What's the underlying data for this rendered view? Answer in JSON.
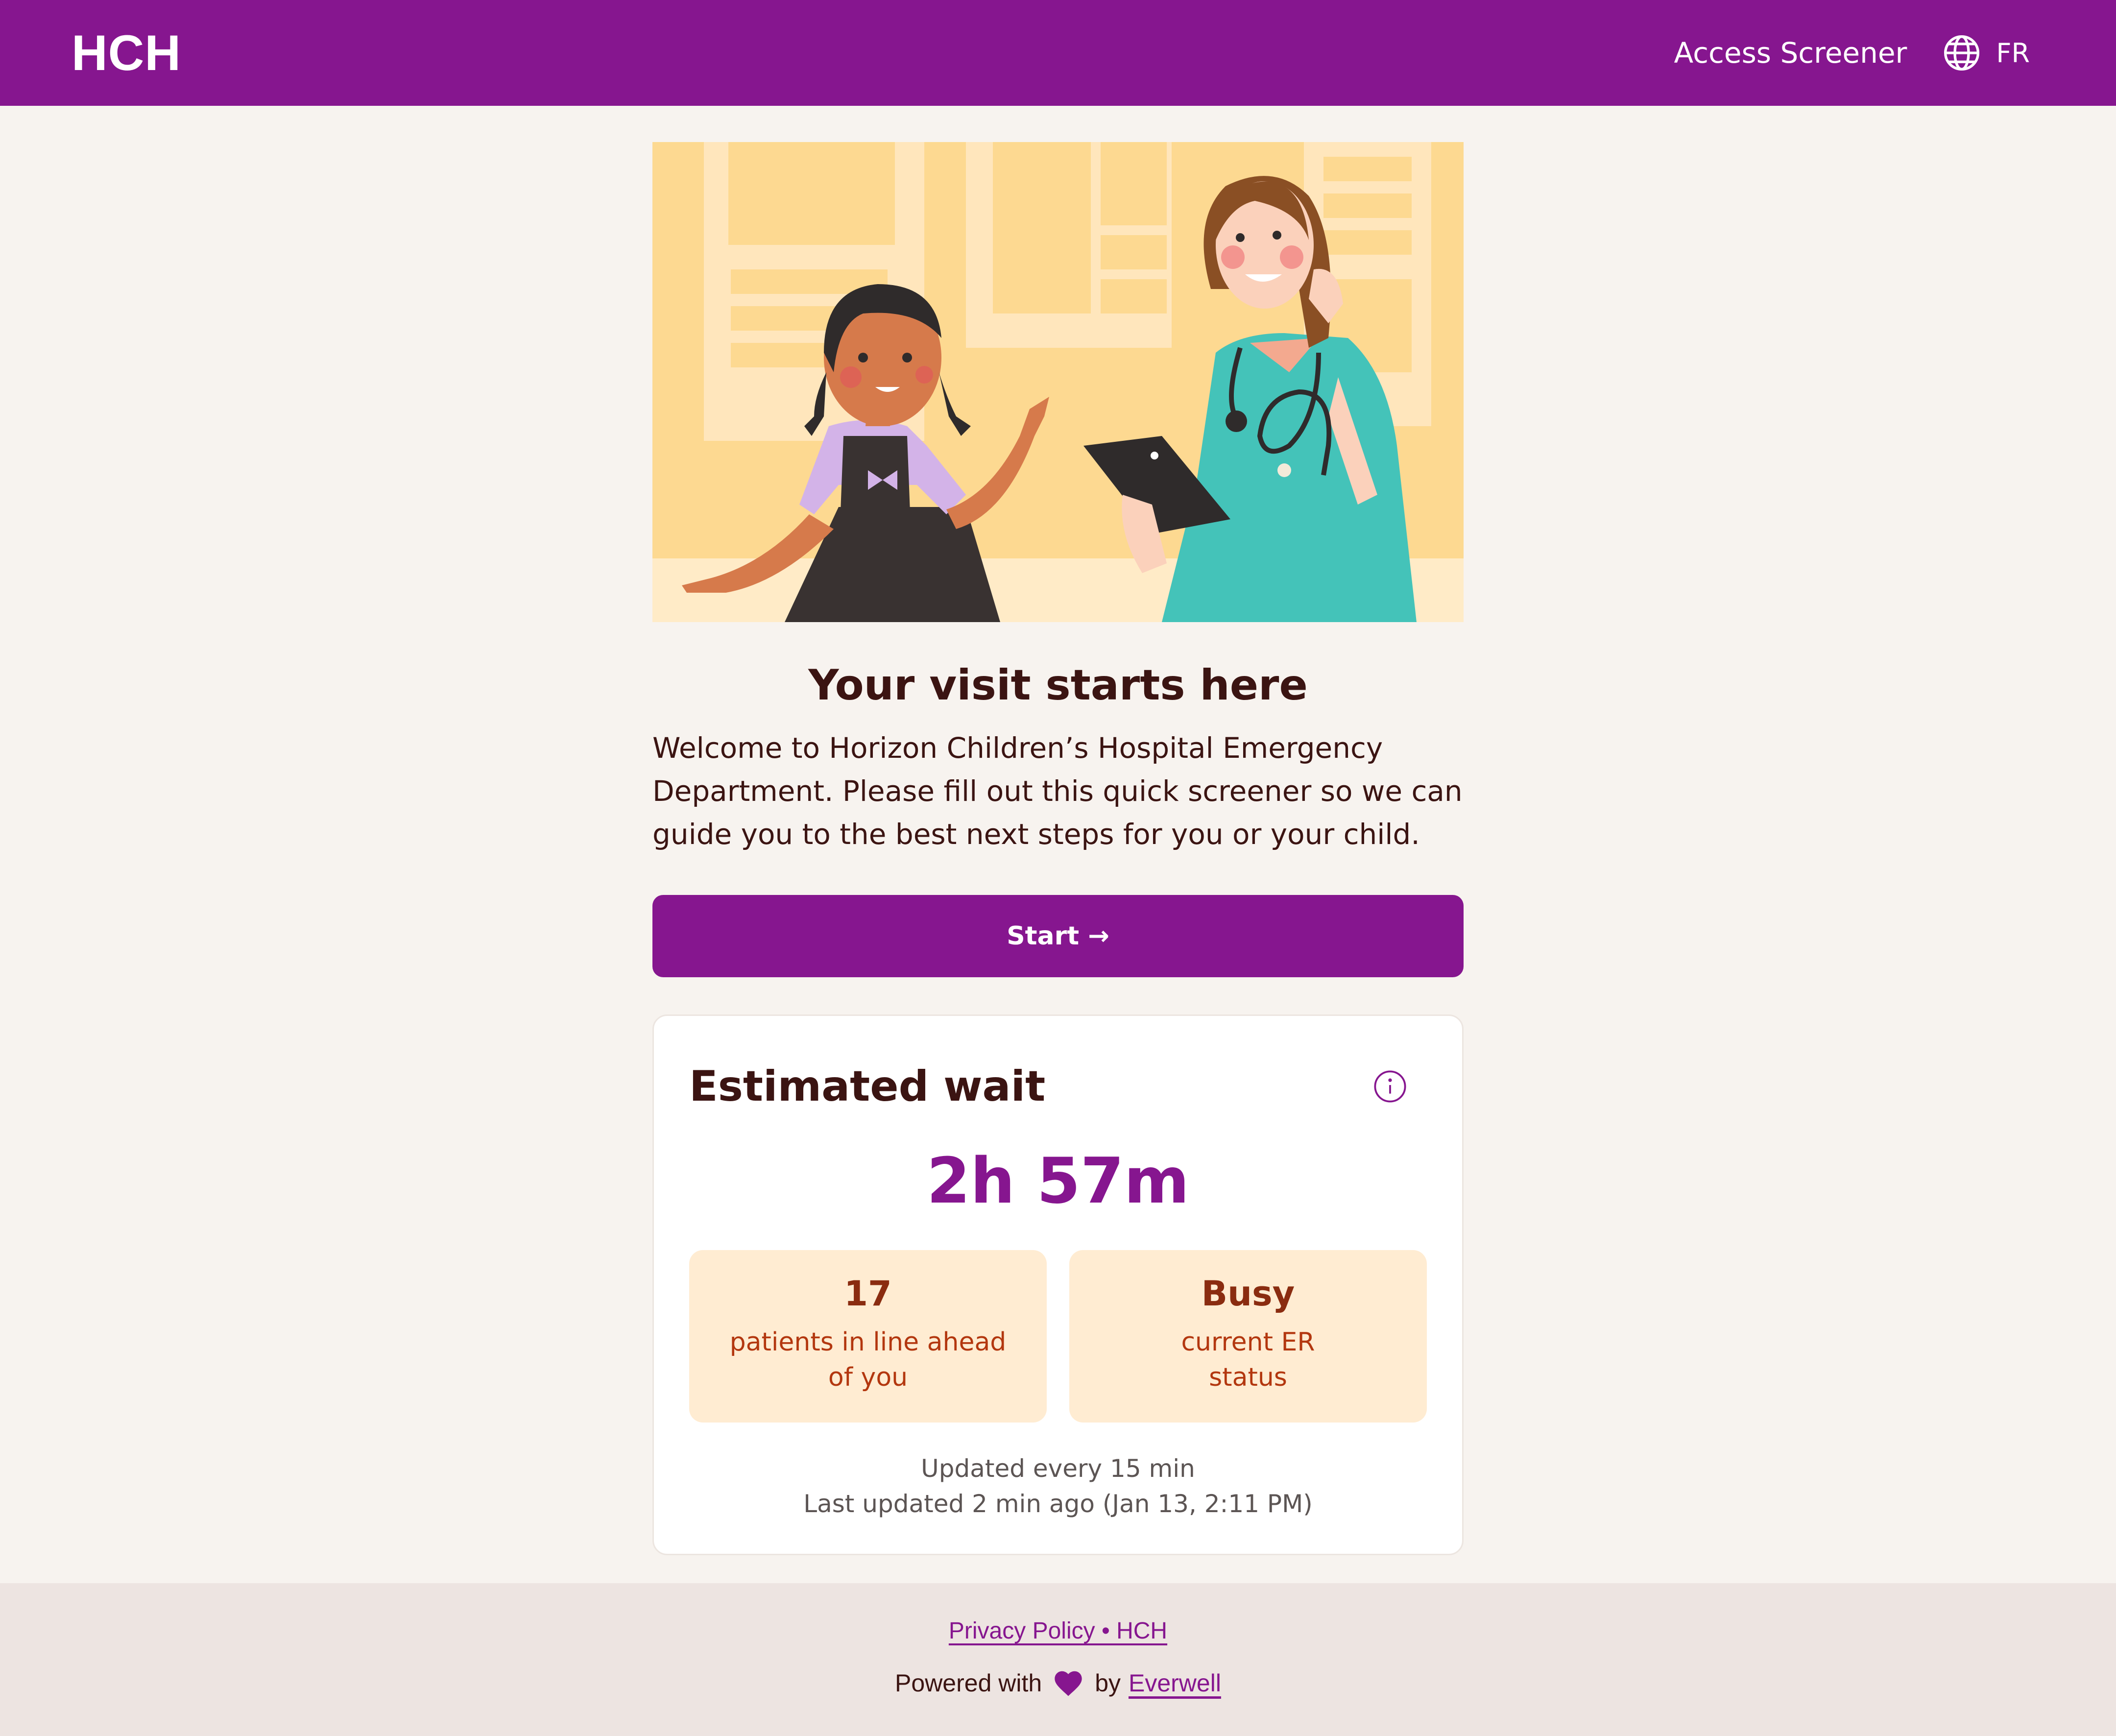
{
  "header": {
    "logo": "HCH",
    "access_link": "Access Screener",
    "language_toggle": "FR",
    "language_icon": "globe-icon",
    "background_color": "#86168f"
  },
  "hero": {
    "illustration": "child-and-nurse-illustration"
  },
  "intro": {
    "title": "Your visit starts here",
    "body": "Welcome to Horizon Children’s Hospital Emergency Department. Please fill out this quick screener so we can guide you to the best next steps for you or your child."
  },
  "start_button": {
    "label": "Start →",
    "color": "#86168f"
  },
  "wait_card": {
    "title": "Estimated wait",
    "info_icon": "info-icon",
    "wait_time": "2h 57m",
    "stats": [
      {
        "value": "17",
        "label": "patients in line ahead of you"
      },
      {
        "value": "Busy",
        "label": "current ER status"
      }
    ],
    "update_frequency": "Updated every 15 min",
    "last_updated": "Last updated 2 min ago (Jan 13, 2:11 PM)"
  },
  "footer": {
    "links": "Privacy Policy • HCH",
    "powered_prefix": "Powered with",
    "heart_icon": "heart-icon",
    "powered_by": "by",
    "vendor": "Everwell"
  }
}
